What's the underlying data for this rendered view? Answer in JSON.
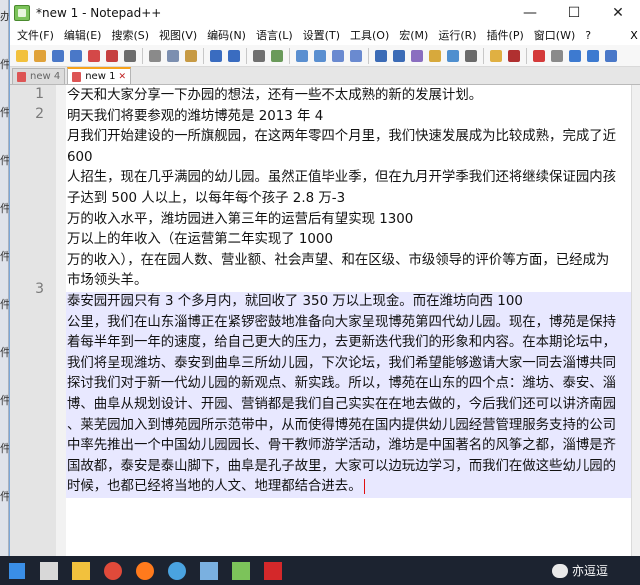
{
  "left_strip": [
    "办",
    "件",
    "件",
    "件",
    "件",
    "件",
    "件",
    "件",
    "件",
    "件",
    "件"
  ],
  "window": {
    "title": "*new 1 - Notepad++",
    "controls": {
      "minimize": "—",
      "maximize": "☐",
      "close": "✕"
    }
  },
  "menu": {
    "items": [
      "文件(F)",
      "编辑(E)",
      "搜索(S)",
      "视图(V)",
      "编码(N)",
      "语言(L)",
      "设置(T)",
      "工具(O)",
      "宏(M)",
      "运行(R)",
      "插件(P)",
      "窗口(W)",
      "?"
    ],
    "right": "X"
  },
  "toolbar": {
    "icons": [
      "new-file",
      "open-file",
      "save",
      "save-all",
      "close",
      "close-all",
      "print",
      "cut",
      "copy",
      "paste",
      "undo",
      "redo",
      "find",
      "replace",
      "zoom-in",
      "zoom-out",
      "sync-vertical",
      "sync-horizontal",
      "word-wrap",
      "show-all-chars",
      "indent-guide",
      "udl",
      "doc-map",
      "function-list",
      "folder-workspace",
      "monitoring",
      "record-macro",
      "stop-record",
      "playback",
      "run-multiple",
      "save-macro"
    ],
    "colors": [
      "#f2c13d",
      "#e0a23a",
      "#4a78c8",
      "#4a78c8",
      "#d44848",
      "#c64040",
      "#6c6c6c",
      "#8a8a8a",
      "#7c8fb0",
      "#c79a44",
      "#3a6cc0",
      "#3a6cc0",
      "#707070",
      "#6a9a5a",
      "#5a8fd0",
      "#5a8fd0",
      "#6a8ad0",
      "#6a8ad0",
      "#3b6bb6",
      "#3b6bb6",
      "#8a6ec0",
      "#d7a93c",
      "#4f8fcf",
      "#6a6a6a",
      "#e0b042",
      "#b03030",
      "#d43a3a",
      "#8a8a8a",
      "#3d7ad0",
      "#3d7ad0",
      "#4a78c8"
    ]
  },
  "tabs": [
    {
      "label": "new 4",
      "active": false,
      "icon_color": "#c44"
    },
    {
      "label": "new 1",
      "active": true,
      "icon_color": "#c44",
      "close": "✕"
    }
  ],
  "editor": {
    "line_numbers": [
      "1",
      "2",
      "3"
    ],
    "paragraphs": [
      {
        "number": "1",
        "lines": [
          "今天和大家分享一下办园的想法，还有一些不太成熟的新的发展计划。"
        ]
      },
      {
        "number": "2",
        "lines": [
          "明天我们将要参观的潍坊博苑是 2013 年 4",
          "月我们开始建设的一所旗舰园，在这两年零四个月里，我们快速发展成为比较成熟，完成了近",
          "600",
          "人招生，现在几乎满园的幼儿园。虽然正值毕业季，但在九月开学季我们还将继续保证园内孩",
          "子达到 500 人以上，以每年每个孩子 2.8 万-3",
          "万的收入水平，潍坊园进入第三年的运营后有望实现 1300",
          "万以上的年收入（在运营第二年实现了 1000",
          "万的收入），在在园人数、营业额、社会声望、和在区级、市级领导的评价等方面，已经成为",
          "市场领头羊。"
        ]
      },
      {
        "number": "3",
        "lines": [
          "泰安园开园只有 3 个多月内，就回收了 350 万以上现金。而在潍坊向西 100",
          "公里，我们在山东淄博正在紧锣密鼓地准备向大家呈现博苑第四代幼儿园。现在，博苑是保持",
          "着每半年到一年的速度，给自己更大的压力，去更新迭代我们的形象和内容。在本期论坛中，",
          "我们将呈现潍坊、泰安到曲阜三所幼儿园，下次论坛，我们希望能够邀请大家一同去淄博共同",
          "探讨我们对于新一代幼儿园的新观点、新实践。所以，博苑在山东的四个点：潍坊、泰安、淄",
          "博、曲阜从规划设计、开园、营销都是我们自己实实在在地去做的，今后我们还可以讲济南园",
          "、莱芜园加入到博苑园所示范带中，从而使得博苑在国内提供幼儿园经营管理服务支持的公司",
          "中率先推出一个中国幼儿园园长、骨干教师游学活动，潍坊是中国著名的风筝之都，淄博是齐",
          "国故都，泰安是泰山脚下，曲阜是孔子故里，大家可以边玩边学习，而我们在做这些幼儿园的",
          "时候，也都已经将当地的人文、地理都结合进去。"
        ]
      }
    ]
  },
  "taskbar": {
    "icons": [
      "windows-start",
      "task-view",
      "file-explorer",
      "chrome",
      "firefox",
      "ie",
      "paint",
      "notepad-plus-plus",
      "acrobat"
    ],
    "colors": [
      "#3a8ee6",
      "#d8d8d8",
      "#f2c13d",
      "#e04a3a",
      "#ff7a1c",
      "#4aa3e0",
      "#7ab0e0",
      "#7cc35a",
      "#d4282a"
    ],
    "watermark": "亦逗逗"
  }
}
